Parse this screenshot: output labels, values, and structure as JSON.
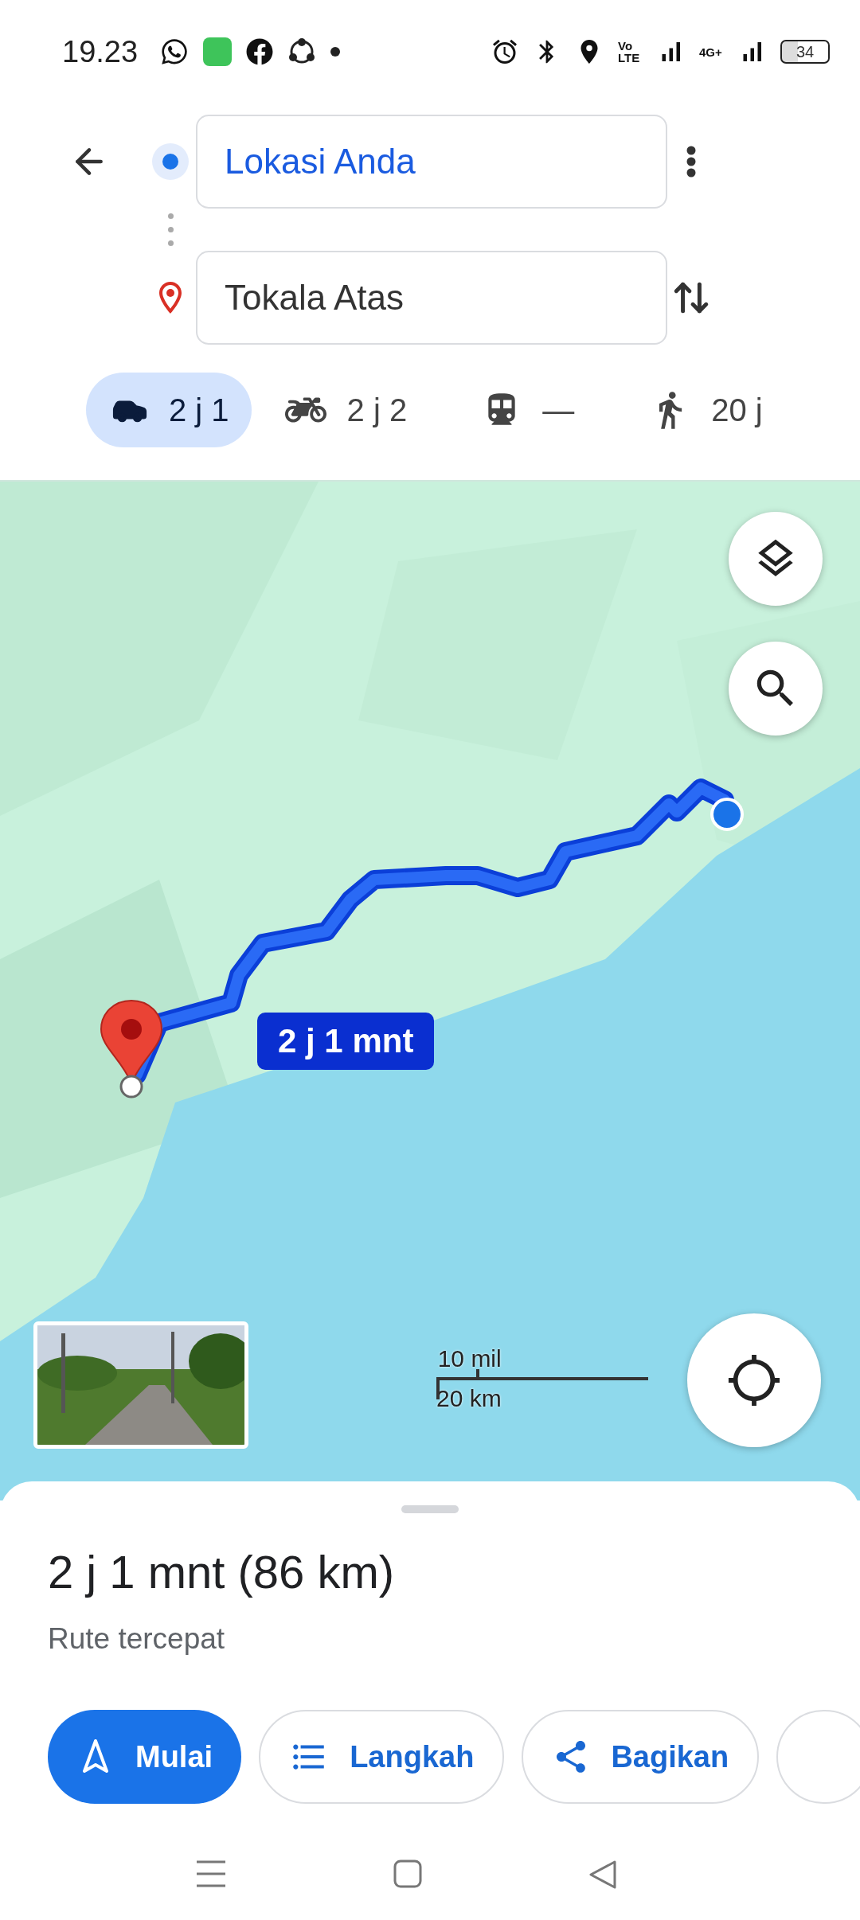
{
  "status_bar": {
    "time": "19.23",
    "volte": [
      "Vo",
      "LTE"
    ],
    "mobile_data": "4G+",
    "battery": "34"
  },
  "directions": {
    "origin": {
      "value": "Lokasi Anda"
    },
    "destination": {
      "value": "Tokala Atas"
    }
  },
  "modes": [
    {
      "kind": "car",
      "label": "2 j 1",
      "selected": true
    },
    {
      "kind": "motorcycle",
      "label": "2 j 2",
      "selected": false
    },
    {
      "kind": "transit",
      "label": "—",
      "selected": false
    },
    {
      "kind": "walk",
      "label": "20 j",
      "selected": false
    }
  ],
  "map": {
    "route_label": "2 j 1 mnt",
    "scale": [
      "10 mil",
      "20 km"
    ],
    "street_view": {
      "kind": "picture"
    }
  },
  "summary": {
    "title": "2 j 1 mnt (86 km)",
    "subtitle": "Rute tercepat"
  },
  "actions": [
    {
      "kind": "start",
      "label": "Mulai"
    },
    {
      "kind": "steps",
      "label": "Langkah"
    },
    {
      "kind": "share",
      "label": "Bagikan"
    }
  ]
}
